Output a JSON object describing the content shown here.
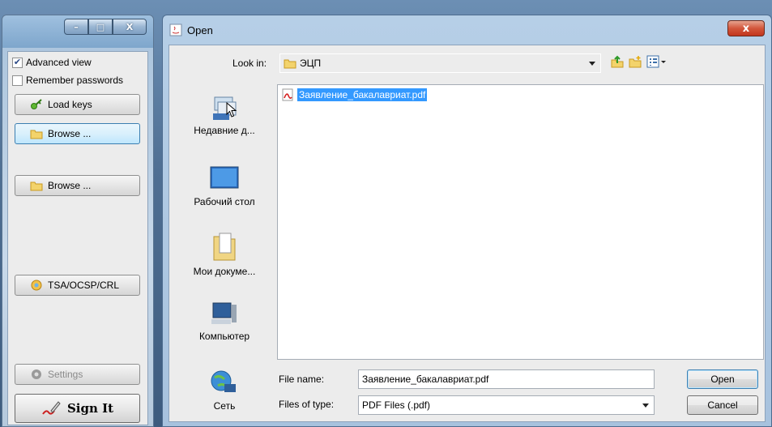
{
  "left_window": {
    "controls": {
      "minimize": "–",
      "maximize": "□",
      "close": "X"
    },
    "checkboxes": [
      {
        "label": "Advanced view",
        "checked": true
      },
      {
        "label": "Remember passwords",
        "checked": false
      }
    ],
    "buttons": {
      "load_keys": "Load keys",
      "browse_1": "Browse ...",
      "browse_2": "Browse ...",
      "tsa": "TSA/OCSP/CRL",
      "settings": "Settings",
      "sign_it": "Sign It"
    }
  },
  "dialog": {
    "title": "Open",
    "close_glyph": "x",
    "look_in_label": "Look in:",
    "look_in_value": "ЭЦП",
    "places": [
      {
        "label": "Недавние д...",
        "icon": "recent-documents-icon"
      },
      {
        "label": "Рабочий стол",
        "icon": "desktop-icon"
      },
      {
        "label": "Мои докуме...",
        "icon": "my-documents-icon"
      },
      {
        "label": "Компьютер",
        "icon": "computer-icon"
      },
      {
        "label": "Сеть",
        "icon": "network-icon"
      }
    ],
    "files": [
      {
        "name": "Заявление_бакалавриат.pdf",
        "selected": true,
        "icon": "pdf-file-icon"
      }
    ],
    "file_name_label": "File name:",
    "file_name_value": "Заявление_бакалавриат.pdf",
    "file_type_label": "Files of type:",
    "file_type_value": "PDF Files (.pdf)",
    "open_button": "Open",
    "cancel_button": "Cancel"
  },
  "colors": {
    "selection": "#3399ff",
    "title_bar": "#a7c2de",
    "close_button": "#c2361e",
    "panel": "#ececec"
  }
}
